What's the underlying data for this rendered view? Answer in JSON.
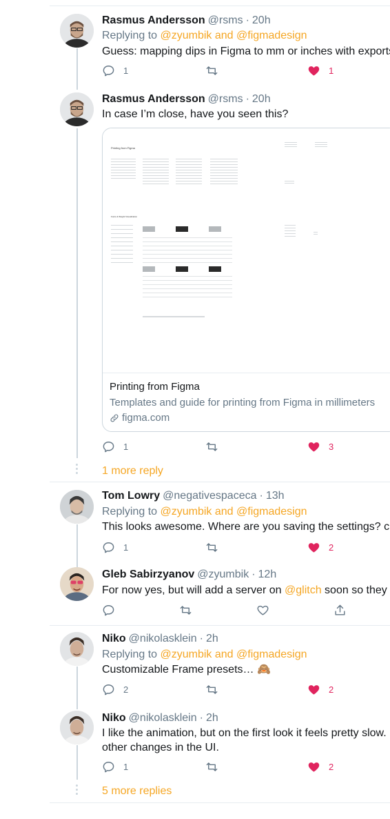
{
  "tweets": [
    {
      "name": "Rasmus Andersson",
      "handle": "@rsms",
      "sep": "·",
      "time": "20h",
      "replying_prefix": "Replying to",
      "replying_to": "@zyumbik and @figmadesign",
      "text": "Guess: mapping dips in Figma to mm or inches with exports",
      "reply_count": "1",
      "like_count": "1"
    },
    {
      "name": "Rasmus Andersson",
      "handle": "@rsms",
      "sep": "·",
      "time": "20h",
      "text": "In case I’m close, have you seen this?",
      "card": {
        "image_title": "Printing from Figma",
        "image_section": "Fonts & Weight Visualization",
        "title": "Printing from Figma",
        "description": "Templates and guide for printing from Figma in millimeters",
        "domain": "figma.com"
      },
      "reply_count": "1",
      "like_count": "3",
      "more_replies": "1 more reply"
    },
    {
      "name": "Tom Lowry",
      "handle": "@negativespaceca",
      "sep": "·",
      "time": "13h",
      "replying_prefix": "Replying to",
      "replying_to": "@zyumbik and @figmadesign",
      "text": "This looks awesome. Where are you saving the settings? clie",
      "reply_count": "1",
      "like_count": "2"
    },
    {
      "name": "Gleb Sabirzyanov",
      "handle": "@zyumbik",
      "sep": "·",
      "time": "12h",
      "text_before": "For now yes, but will add a server on ",
      "text_mention": "@glitch",
      "text_after": " soon so they a"
    },
    {
      "name": "Niko",
      "handle": "@nikolasklein",
      "sep": "·",
      "time": "2h",
      "replying_prefix": "Replying to",
      "replying_to": "@zyumbik and @figmadesign",
      "text": "Customizable Frame presets… 🙈",
      "reply_count": "2",
      "like_count": "2"
    },
    {
      "name": "Niko",
      "handle": "@nikolasklein",
      "sep": "·",
      "time": "2h",
      "text_line1": "I like the animation, but on the first look it feels pretty slow. I",
      "text_line2": "other changes in the UI.",
      "reply_count": "1",
      "like_count": "2",
      "more_replies": "5 more replies"
    }
  ],
  "icons": {
    "reply": "reply-icon",
    "retweet": "retweet-icon",
    "like": "heart-icon",
    "share": "share-icon",
    "link": "link-icon"
  },
  "colors": {
    "accent": "#f5a623",
    "like": "#e0245e",
    "muted": "#657786",
    "thread": "#ccd6dd"
  }
}
